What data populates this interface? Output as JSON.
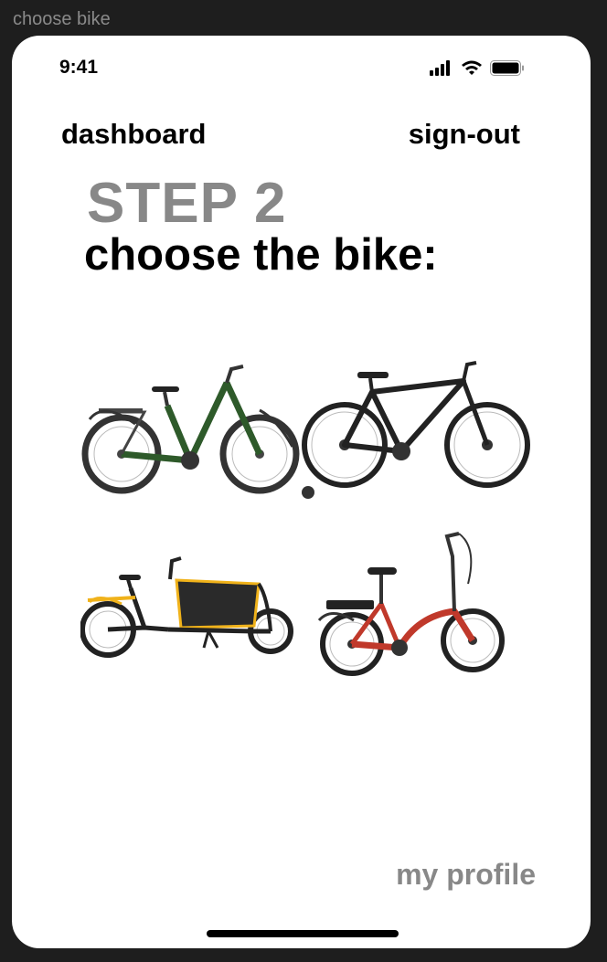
{
  "frame": {
    "label": "choose bike"
  },
  "status_bar": {
    "time": "9:41",
    "icons": [
      "signal-icon",
      "wifi-icon",
      "battery-icon"
    ]
  },
  "nav": {
    "dashboard_label": "dashboard",
    "signout_label": "sign-out"
  },
  "step": {
    "title": "STEP 2",
    "subtitle": "choose the bike:"
  },
  "bikes": [
    {
      "id": "bike-green-step-through",
      "color": "#2e5a2a"
    },
    {
      "id": "bike-black-hybrid",
      "color": "#222222"
    },
    {
      "id": "bike-cargo",
      "color": "#1a1a1a",
      "accent": "#f0b21a"
    },
    {
      "id": "bike-red-folding",
      "color": "#c0392b"
    }
  ],
  "footer": {
    "profile_label": "my profile"
  },
  "colors": {
    "background": "#1e1e1e",
    "screen": "#ffffff",
    "muted_text": "#888888",
    "primary_text": "#000000"
  }
}
